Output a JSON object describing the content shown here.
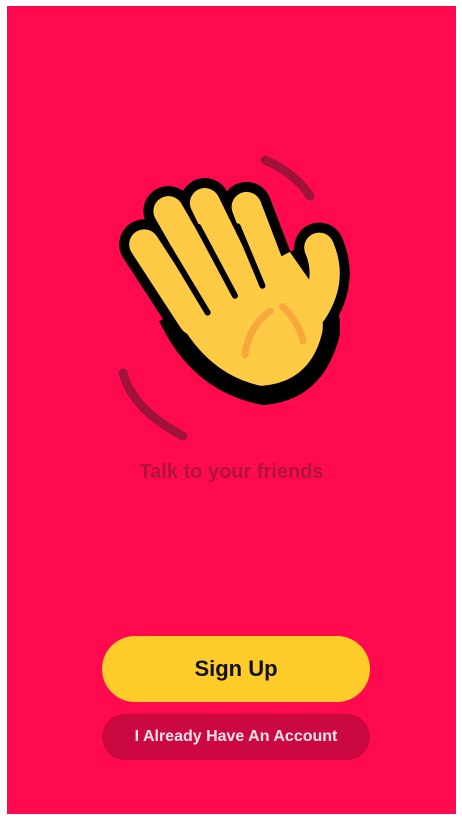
{
  "hero": {
    "icon": "waving-hand-icon",
    "colors": {
      "background": "#ff0a4e",
      "hand_fill": "#ffcb45",
      "hand_outline": "#000000",
      "motion_lines": "#a0123a"
    }
  },
  "tagline": "Talk to your friends",
  "actions": {
    "sign_up_label": "Sign Up",
    "existing_account_label": "I Already Have An Account"
  },
  "colors": {
    "accent": "#ffcc29",
    "secondary_button": "#cc0840",
    "tagline": "#b0143c"
  }
}
